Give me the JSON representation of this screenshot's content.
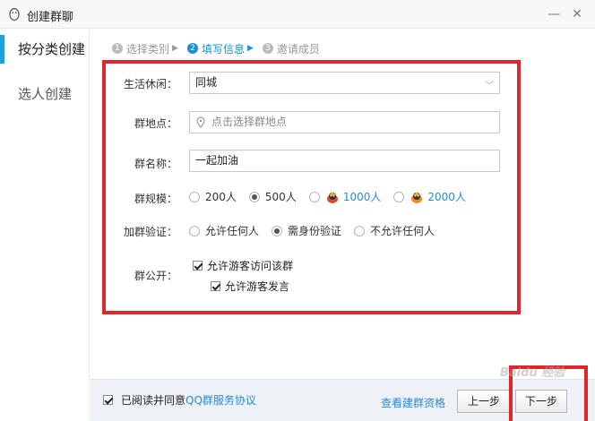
{
  "window": {
    "title": "创建群聊",
    "minimize_icon": "minimize-icon",
    "close_icon": "close-icon"
  },
  "sidebar": {
    "items": [
      {
        "label": "按分类创建",
        "active": true
      },
      {
        "label": "选人创建",
        "active": false
      }
    ]
  },
  "steps": [
    {
      "num": "1",
      "label": "选择类别",
      "active": false
    },
    {
      "num": "2",
      "label": "填写信息",
      "active": true
    },
    {
      "num": "3",
      "label": "邀请成员",
      "active": false
    }
  ],
  "form": {
    "category": {
      "label": "生活休闲：",
      "value": "同城"
    },
    "location": {
      "label": "群地点：",
      "placeholder": "点击选择群地点"
    },
    "name": {
      "label": "群名称：",
      "value": "一起加油"
    },
    "size": {
      "label": "群规模：",
      "options": [
        {
          "label": "200人",
          "checked": false
        },
        {
          "label": "500人",
          "checked": true
        },
        {
          "label": "1000人",
          "checked": false,
          "vip": true
        },
        {
          "label": "2000人",
          "checked": false,
          "vip": true
        }
      ]
    },
    "verify": {
      "label": "加群验证：",
      "options": [
        {
          "label": "允许任何人",
          "checked": false
        },
        {
          "label": "需身份验证",
          "checked": true
        },
        {
          "label": "不允许任何人",
          "checked": false
        }
      ]
    },
    "public": {
      "label": "群公开：",
      "allow_visit": "允许游客访问该群",
      "allow_speak": "允许游客发言"
    }
  },
  "footer": {
    "agree_prefix": "已阅读并同意",
    "agree_link": "QQ群服务协议",
    "check_qualification": "查看建群资格",
    "prev": "上一步",
    "next": "下一步"
  },
  "watermark": "Baidu 经验",
  "colors": {
    "accent": "#1ba1e2",
    "link": "#2a8ad4",
    "highlight_box": "#e0262b"
  }
}
